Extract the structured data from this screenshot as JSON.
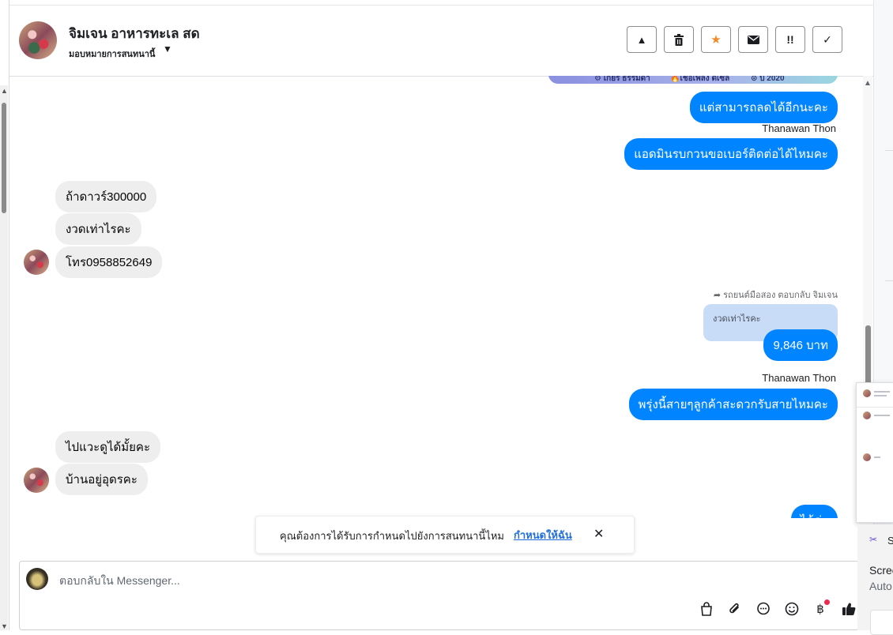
{
  "header": {
    "contact_name": "จิมเจน อาหารทะเล สด",
    "assign_label": "มอบหมายการสนทนานี้",
    "actions": [
      {
        "name": "report-spam-button",
        "icon": "warning-triangle-icon",
        "glyph": "▲"
      },
      {
        "name": "delete-button",
        "icon": "trash-icon",
        "glyph": "🗑"
      },
      {
        "name": "star-button",
        "icon": "star-icon",
        "glyph": "★"
      },
      {
        "name": "mark-unread-button",
        "icon": "envelope-icon",
        "glyph": "✉"
      },
      {
        "name": "follow-up-button",
        "icon": "exclamation-icon",
        "glyph": "!!"
      },
      {
        "name": "mark-done-button",
        "icon": "check-icon",
        "glyph": "✓"
      }
    ]
  },
  "banner": {
    "gear": "เกียร์ ธรรมดา",
    "fuel": "เชื้อเพลิง ดีเซล",
    "year": "ปี 2020"
  },
  "messages": {
    "out_1": "แต่สามารถลดได้อีกนะคะ",
    "sender_1": "Thanawan Thon",
    "out_2": "แอดมินรบกวนขอเบอร์ติดต่อได้ไหมคะ",
    "in_1": "ถ้าดาวร์300000",
    "in_2": "งวดเท่าไรคะ",
    "in_3": "โทร0958852649",
    "reply_meta": "รถยนต์มือสอง ตอบกลับ จิมเจน",
    "quoted": "งวดเท่าไรคะ",
    "out_3": "9,846 บาท",
    "sender_2": "Thanawan Thon",
    "out_4": "พรุ่งนี้สายๆลูกค้าสะดวกรับสายไหมคะ",
    "in_4": "ไปแวะดูได้มั้ยคะ",
    "in_5": "บ้านอยู่อุดรคะ",
    "out_5_partial": "ได้ค่ะ"
  },
  "notice": {
    "text": "คุณต้องการได้รับการกำหนดไปยังการสนทนานี้ไหม",
    "link": "กำหนดให้ฉัน",
    "close": "✕"
  },
  "composer": {
    "placeholder": "ตอบกลับใน Messenger..."
  },
  "tools": [
    {
      "name": "shop-bag-icon",
      "glyph": "👜"
    },
    {
      "name": "attachment-icon",
      "glyph": "📎"
    },
    {
      "name": "saved-reply-icon",
      "glyph": "💬"
    },
    {
      "name": "emoji-icon",
      "glyph": "☺"
    },
    {
      "name": "payment-baht-icon",
      "glyph": "฿"
    },
    {
      "name": "thumbs-up-icon",
      "glyph": "👍"
    }
  ],
  "side_panel": {
    "snip_letter": "S",
    "snip_title": "Screen",
    "snip_sub": "Auto"
  },
  "colors": {
    "outgoing_bubble": "#0084ff",
    "incoming_bubble": "#eeeeee",
    "link": "#216fdb",
    "star": "#f28c28",
    "quoted_bg": "#c8dcf8"
  }
}
